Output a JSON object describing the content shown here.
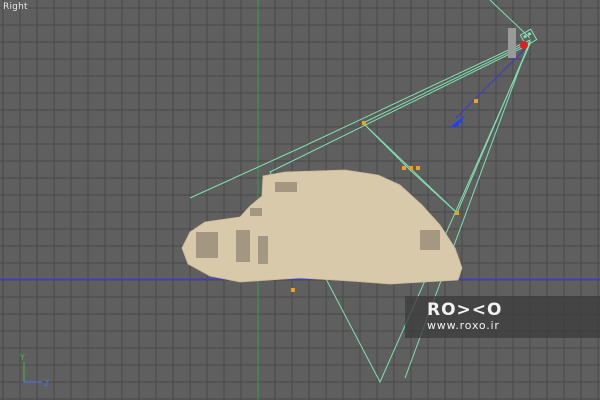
{
  "viewport": {
    "label": "Right",
    "background_color": "#5f5f5f",
    "grid_color": "#4a4a4a",
    "axis_color_horizontal": "#3a3aff",
    "axis_color_vertical": "#2e9e4e",
    "wireframe_color": "#7fe0b0"
  },
  "axis_tripod": {
    "y_label": "Y",
    "z_label": "Z",
    "y_color": "#4caf50",
    "z_color": "#4a6cff"
  },
  "scene_objects": {
    "camera_icon": "camera-icon",
    "mesh_color": "#d9c9ab",
    "handle_color": "#f0a020",
    "camera_origin_color": "#e02020",
    "direction_arrow_color": "#2040ff"
  },
  "watermark": {
    "logo": "RO><O",
    "url": "www.roxo.ir"
  }
}
